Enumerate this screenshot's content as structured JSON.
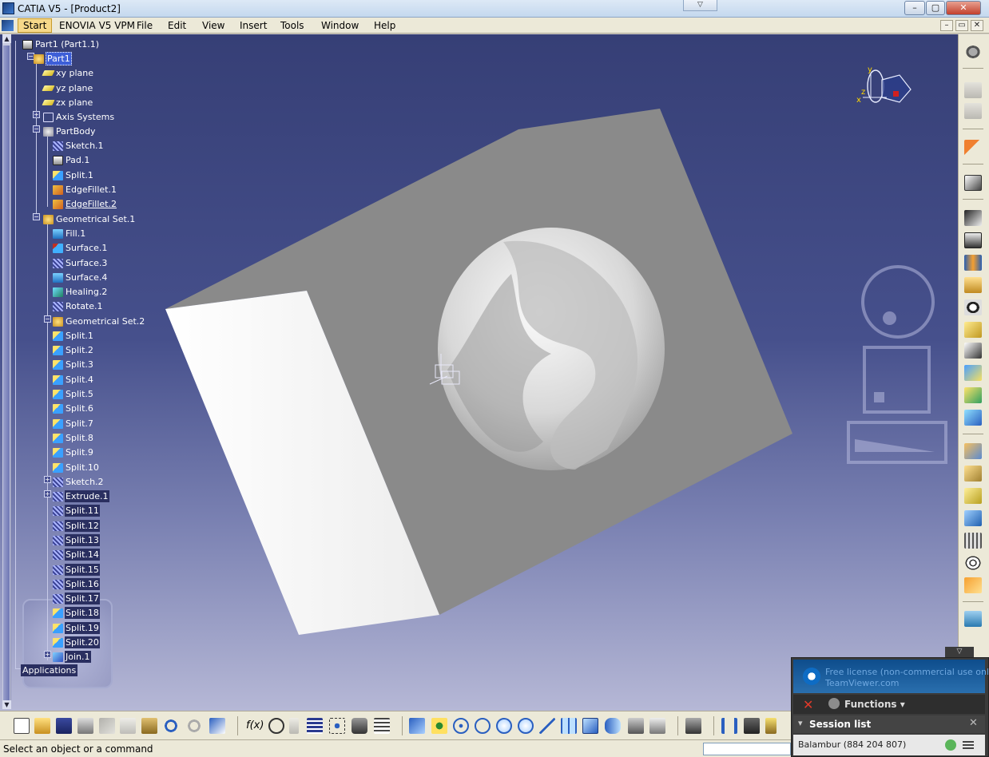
{
  "window": {
    "title": "CATIA V5 - [Product2]",
    "quick_menu_glyph": "▽",
    "minimize": "–",
    "maximize": "▢",
    "close": "✕"
  },
  "menu": {
    "items": [
      "Start",
      "ENOVIA V5 VPM",
      "File",
      "Edit",
      "View",
      "Insert",
      "Tools",
      "Window",
      "Help"
    ],
    "mdi_minimize": "–",
    "mdi_restore": "▭",
    "mdi_close": "✕"
  },
  "tree": {
    "root": "Part1 (Part1.1)",
    "part": "Part1",
    "planes": [
      "xy plane",
      "yz plane",
      "zx plane"
    ],
    "axis_systems": "Axis Systems",
    "part_body": "PartBody",
    "body_items": [
      "Sketch.1",
      "Pad.1",
      "Split.1",
      "EdgeFillet.1",
      "EdgeFillet.2"
    ],
    "gset1": "Geometrical Set.1",
    "gset1_items": [
      "Fill.1",
      "Surface.1",
      "Surface.3",
      "Surface.4",
      "Healing.2",
      "Rotate.1"
    ],
    "gset2": "Geometrical Set.2",
    "gset2_items": [
      "Split.1",
      "Split.2",
      "Split.3",
      "Split.4",
      "Split.5",
      "Split.6",
      "Split.7",
      "Split.8",
      "Split.9",
      "Split.10"
    ],
    "tail_items": [
      "Sketch.2",
      "Extrude.1",
      "Split.11",
      "Split.12",
      "Split.13",
      "Split.14",
      "Split.15",
      "Split.16",
      "Split.17",
      "Split.18",
      "Split.19",
      "Split.20",
      "Join.1"
    ],
    "applications": "Applications"
  },
  "compass": {
    "x": "x",
    "y": "y",
    "z": "z"
  },
  "status": {
    "prompt": "Select an object or a command"
  },
  "teamviewer": {
    "license_line1": "Free license (non-commercial use only)",
    "license_line2": "TeamViewer.com",
    "close_glyph": "✕",
    "functions": "Functions ▾",
    "session_toggle": "▾",
    "session_list": "Session list",
    "session_close": "✕",
    "partner": "Balambur (884 204 807)"
  },
  "colors": {
    "viewport_top": "#363f76",
    "viewport_bottom": "#b6b8d6",
    "selection": "#3d5fd8",
    "part_gray": "#8a8a8a",
    "part_light": "#f4f4f4"
  }
}
